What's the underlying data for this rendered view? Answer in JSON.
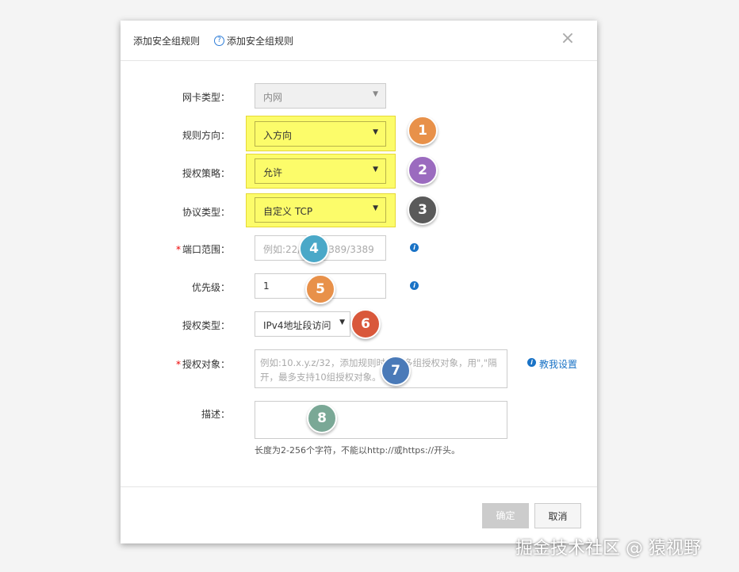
{
  "dialog": {
    "title": "添加安全组规则",
    "help_icon": "?",
    "subtitle": "添加安全组规则",
    "close_icon": "×"
  },
  "form": {
    "nic_type": {
      "label": "网卡类型：",
      "value": "内网"
    },
    "direction": {
      "label": "规则方向：",
      "value": "入方向"
    },
    "policy": {
      "label": "授权策略：",
      "value": "允许"
    },
    "protocol": {
      "label": "协议类型：",
      "value": "自定义 TCP"
    },
    "port_range": {
      "required": "*",
      "label": "端口范围：",
      "placeholder": "例如:22/22或3389/3389"
    },
    "priority": {
      "label": "优先级：",
      "value": "1"
    },
    "auth_type": {
      "label": "授权类型：",
      "value": "IPv4地址段访问"
    },
    "auth_object": {
      "required": "*",
      "label": "授权对象：",
      "placeholder": "例如:10.x.y.z/32，添加规则时支持多组授权对象，用\",\"隔开，最多支持10组授权对象。",
      "teach_link": "教我设置"
    },
    "description": {
      "label": "描述：",
      "value": "",
      "hint": "长度为2-256个字符，不能以http://或https://开头。"
    }
  },
  "caret": "▼",
  "info_glyph": "i",
  "buttons": {
    "ok": "确定",
    "cancel": "取消"
  },
  "badges": [
    {
      "number": "1",
      "color": "#e8914a"
    },
    {
      "number": "2",
      "color": "#9b6bbf"
    },
    {
      "number": "3",
      "color": "#5a5a5a"
    },
    {
      "number": "4",
      "color": "#4aa8c8"
    },
    {
      "number": "5",
      "color": "#e8914a"
    },
    {
      "number": "6",
      "color": "#d9583b"
    },
    {
      "number": "7",
      "color": "#4a7ab8"
    },
    {
      "number": "8",
      "color": "#7aa896"
    }
  ],
  "highlight_color": "#fcfc6a",
  "watermark": "掘金技术社区 @ 猿视野"
}
